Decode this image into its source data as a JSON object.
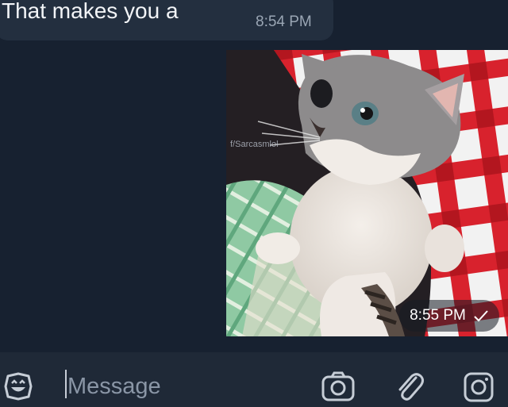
{
  "messages": {
    "incoming": {
      "text": "That makes you a",
      "time": "8:54 PM"
    },
    "outgoing_photo": {
      "watermark": "f/Sarcasmlol",
      "time": "8:55 PM",
      "status_icon": "single-check-icon",
      "subject": "kitten-photo"
    }
  },
  "composer": {
    "placeholder": "Message",
    "icons": [
      "emoji-icon",
      "camera-icon",
      "attach-icon",
      "instagram-icon"
    ]
  },
  "colors": {
    "background": "#172130",
    "incoming_bubble": "#232f3f",
    "composer": "#1f2937",
    "icons": "#c6cdd6"
  }
}
